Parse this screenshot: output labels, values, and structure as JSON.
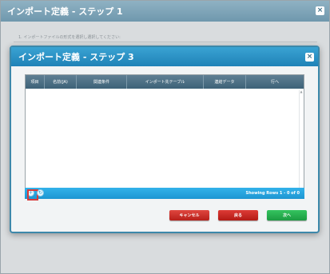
{
  "outer_window": {
    "title": "インポート定義 - ステップ 1",
    "instruction": "1. インポートファイルの形式を選択し選択してください:"
  },
  "modal": {
    "title": "インポート定義 - ステップ 3",
    "grid": {
      "columns": [
        "項目",
        "名前(JA)",
        "関連条件",
        "インポート先テーブル",
        "連結データ",
        "行へ"
      ],
      "rows": []
    },
    "pager": {
      "status": "Showing Rows 1 - 0 of 0"
    },
    "buttons": {
      "cancel": "キャンセル",
      "back": "戻る",
      "next": "次へ"
    }
  },
  "icons": {
    "close": "close-icon",
    "add": "add-icon",
    "refresh": "refresh-icon"
  },
  "colors": {
    "header_blue": "#1f82b7",
    "pager_blue": "#1d96d2",
    "cancel_red": "#b71f1a",
    "next_green": "#1c9b42",
    "highlight_red": "#d83a3a"
  }
}
